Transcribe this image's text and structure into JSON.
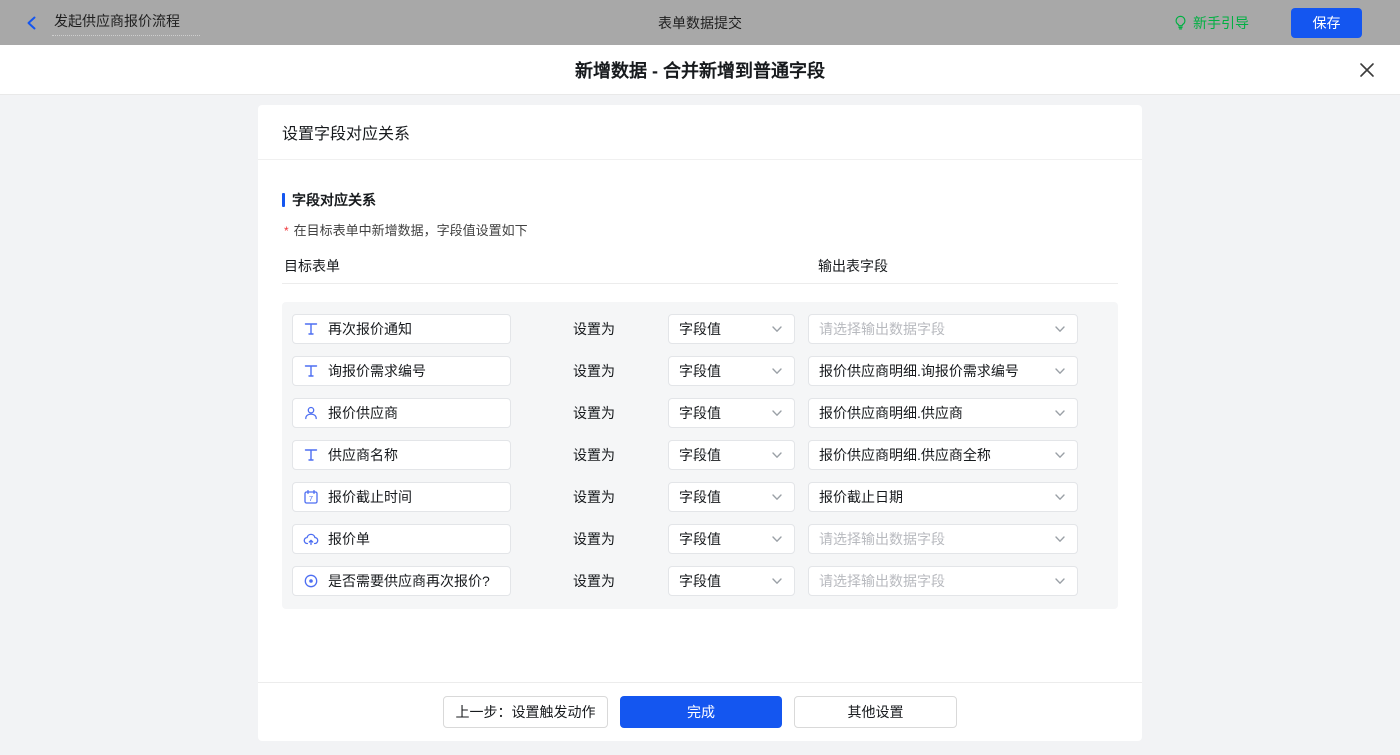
{
  "topbar": {
    "flow_name": "发起供应商报价流程",
    "center_title": "表单数据提交",
    "guide_label": "新手引导",
    "save_label": "保存"
  },
  "modal": {
    "title": "新增数据 - 合并新增到普通字段"
  },
  "panel": {
    "header": "设置字段对应关系",
    "section_title": "字段对应关系",
    "hint": "在目标表单中新增数据，字段值设置如下",
    "col_target": "目标表单",
    "col_output": "输出表字段",
    "set_as_label": "设置为"
  },
  "rows": [
    {
      "icon": "text-field-icon",
      "field": "再次报价通知",
      "mode": "字段值",
      "output": "请选择输出数据字段",
      "placeholder": true
    },
    {
      "icon": "text-field-icon",
      "field": "询报价需求编号",
      "mode": "字段值",
      "output": "报价供应商明细.询报价需求编号",
      "placeholder": false
    },
    {
      "icon": "person-icon",
      "field": "报价供应商",
      "mode": "字段值",
      "output": "报价供应商明细.供应商",
      "placeholder": false
    },
    {
      "icon": "text-field-icon",
      "field": "供应商名称",
      "mode": "字段值",
      "output": "报价供应商明细.供应商全称",
      "placeholder": false
    },
    {
      "icon": "calendar-icon",
      "field": "报价截止时间",
      "mode": "字段值",
      "output": "报价截止日期",
      "placeholder": false
    },
    {
      "icon": "cloud-upload-icon",
      "field": "报价单",
      "mode": "字段值",
      "output": "请选择输出数据字段",
      "placeholder": true
    },
    {
      "icon": "radio-icon",
      "field": "是否需要供应商再次报价?",
      "mode": "字段值",
      "output": "请选择输出数据字段",
      "placeholder": true
    }
  ],
  "footer": {
    "prev_label": "上一步：设置触发动作",
    "finish_label": "完成",
    "other_label": "其他设置"
  },
  "colors": {
    "primary_blue": "#1456F0",
    "guide_green": "#00B042",
    "icon_blue": "#4D6EF2",
    "placeholder_gray": "#B8BABF"
  }
}
